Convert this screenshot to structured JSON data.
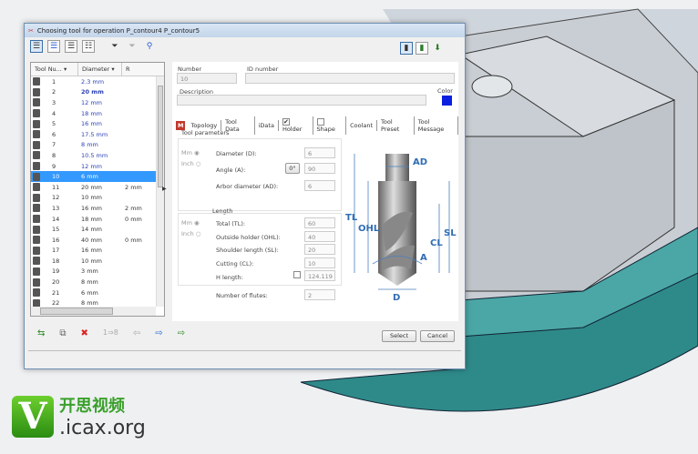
{
  "dialog": {
    "title": "Choosing tool for operation P_contour4 P_contour5"
  },
  "list": {
    "headers": [
      "Tool Nu...",
      "Diameter",
      "R"
    ],
    "rows": [
      {
        "n": "1",
        "d": "2.3 mm",
        "r": ""
      },
      {
        "n": "2",
        "d": "20 mm",
        "r": ""
      },
      {
        "n": "3",
        "d": "12 mm",
        "r": ""
      },
      {
        "n": "4",
        "d": "18 mm",
        "r": ""
      },
      {
        "n": "5",
        "d": "16 mm",
        "r": ""
      },
      {
        "n": "6",
        "d": "17.5 mm",
        "r": ""
      },
      {
        "n": "7",
        "d": "8 mm",
        "r": ""
      },
      {
        "n": "8",
        "d": "10.5 mm",
        "r": ""
      },
      {
        "n": "9",
        "d": "12 mm",
        "r": ""
      },
      {
        "n": "10",
        "d": "6 mm",
        "r": ""
      },
      {
        "n": "11",
        "d": "20 mm",
        "r": "2 mm"
      },
      {
        "n": "12",
        "d": "10 mm",
        "r": ""
      },
      {
        "n": "13",
        "d": "16 mm",
        "r": "2 mm"
      },
      {
        "n": "14",
        "d": "18 mm",
        "r": "0 mm"
      },
      {
        "n": "15",
        "d": "14 mm",
        "r": ""
      },
      {
        "n": "16",
        "d": "40 mm",
        "r": "0 mm"
      },
      {
        "n": "17",
        "d": "16 mm",
        "r": ""
      },
      {
        "n": "18",
        "d": "10 mm",
        "r": ""
      },
      {
        "n": "19",
        "d": "3 mm",
        "r": ""
      },
      {
        "n": "20",
        "d": "8 mm",
        "r": ""
      },
      {
        "n": "21",
        "d": "6 mm",
        "r": ""
      },
      {
        "n": "22",
        "d": "8 mm",
        "r": ""
      }
    ]
  },
  "form": {
    "number_label": "Number",
    "number": "10",
    "id_label": "ID number",
    "desc_label": "Description",
    "color_label": "Color",
    "color": "#0a1fe0"
  },
  "tabs": [
    "Topology",
    "Tool Data",
    "iData",
    "Holder",
    "Shape",
    "Coolant",
    "Tool Preset",
    "Tool Message"
  ],
  "params": {
    "group": "Tool parameters",
    "mm": "Mm",
    "inch": "Inch",
    "diameter_label": "Diameter (D):",
    "diameter": "6",
    "angle_label": "Angle (A):",
    "angle_btn": "0°",
    "angle": "90",
    "arbor_label": "Arbor diameter (AD):",
    "arbor": "6"
  },
  "length": {
    "group": "Length",
    "mm": "Mm",
    "inch": "Inch",
    "total_label": "Total (TL):",
    "total": "60",
    "ohl_label": "Outside holder (OHL):",
    "ohl": "40",
    "sl_label": "Shoulder length (SL):",
    "sl": "20",
    "cl_label": "Cutting (CL):",
    "cl": "10",
    "h_label": "H length:",
    "h": "124.119",
    "flutes_label": "Number of flutes:",
    "flutes": "2"
  },
  "diagram": {
    "AD": "AD",
    "TL": "TL",
    "OHL": "OHL",
    "SL": "SL",
    "CL": "CL",
    "A": "A",
    "D": "D"
  },
  "buttons": {
    "select": "Select",
    "cancel": "Cancel",
    "renumber": "1⇒8"
  },
  "watermark": {
    "logo": "V",
    "cn": "开思视频",
    "site": ".icax.org"
  }
}
